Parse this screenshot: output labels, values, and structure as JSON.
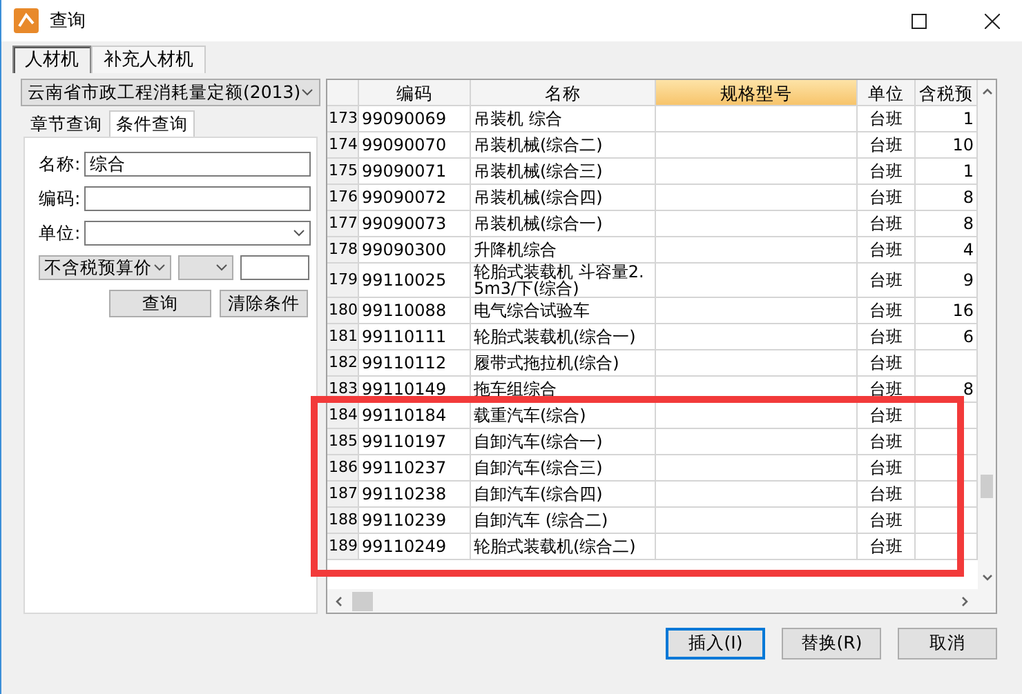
{
  "window": {
    "title": "查询"
  },
  "tabs": [
    {
      "label": "人材机",
      "selected": true
    },
    {
      "label": "补充人材机",
      "selected": false
    }
  ],
  "left_panel": {
    "library": "云南省市政工程消耗量定额(2013)",
    "subtabs": [
      {
        "label": "章节查询",
        "selected": false
      },
      {
        "label": "条件查询",
        "selected": true
      }
    ],
    "fields": [
      {
        "kind": "text",
        "label": "名称:",
        "value": "综合"
      },
      {
        "kind": "text",
        "label": "编码:"
      },
      {
        "kind": "select",
        "label": "单位:"
      }
    ],
    "price_type": "不含税预算价",
    "buttons": [
      "查询",
      "清除条件"
    ]
  },
  "table": {
    "columns": [
      {
        "label": "编码",
        "selected": false
      },
      {
        "label": "名称",
        "selected": false
      },
      {
        "label": "规格型号",
        "selected": true
      },
      {
        "label": "单位",
        "selected": false
      },
      {
        "label": "含税预",
        "selected": false
      }
    ],
    "rows": [
      {
        "index": "173",
        "code": "99090069",
        "name": "吊装机 综合",
        "unit": "台班",
        "price": "1"
      },
      {
        "index": "174",
        "code": "99090070",
        "name": "吊装机械(综合二)",
        "unit": "台班",
        "price": "10"
      },
      {
        "index": "175",
        "code": "99090071",
        "name": "吊装机械(综合三)",
        "unit": "台班",
        "price": "1"
      },
      {
        "index": "176",
        "code": "99090072",
        "name": "吊装机械(综合四)",
        "unit": "台班",
        "price": "8"
      },
      {
        "index": "177",
        "code": "99090073",
        "name": "吊装机械(综合一)",
        "unit": "台班",
        "price": "8"
      },
      {
        "index": "178",
        "code": "99090300",
        "name": "升降机综合",
        "unit": "台班",
        "price": "4"
      },
      {
        "index": "179",
        "code": "99110025",
        "name": "轮胎式装载机 斗容量2.5m3/下(综合)",
        "unit": "台班",
        "price": "9"
      },
      {
        "index": "180",
        "code": "99110088",
        "name": "电气综合试验车",
        "unit": "台班",
        "price": "16"
      },
      {
        "index": "181",
        "code": "99110111",
        "name": "轮胎式装载机(综合一)",
        "unit": "台班",
        "price": "6"
      },
      {
        "index": "182",
        "code": "99110112",
        "name": "履带式拖拉机(综合)",
        "unit": "台班"
      },
      {
        "index": "183",
        "code": "99110149",
        "name": "拖车组综合",
        "unit": "台班",
        "price": "8"
      }
    ],
    "highlighted_rows": [
      {
        "index": "184",
        "code": "99110184",
        "name": "载重汽车(综合)",
        "unit": "台班"
      },
      {
        "index": "185",
        "code": "99110197",
        "name": "自卸汽车(综合一)",
        "unit": "台班"
      },
      {
        "index": "186",
        "code": "99110237",
        "name": "自卸汽车(综合三)",
        "unit": "台班"
      },
      {
        "index": "187",
        "code": "99110238",
        "name": "自卸汽车(综合四)",
        "unit": "台班"
      },
      {
        "index": "188",
        "code": "99110239",
        "name": "自卸汽车 (综合二)",
        "unit": "台班"
      },
      {
        "index": "189",
        "code": "99110249",
        "name": "轮胎式装载机(综合二)",
        "unit": "台班"
      }
    ]
  },
  "buttons": [
    {
      "label": "插入(I)",
      "focused": true
    },
    {
      "label": "替换(R)",
      "focused": false
    },
    {
      "label": "取消",
      "focused": false
    }
  ]
}
